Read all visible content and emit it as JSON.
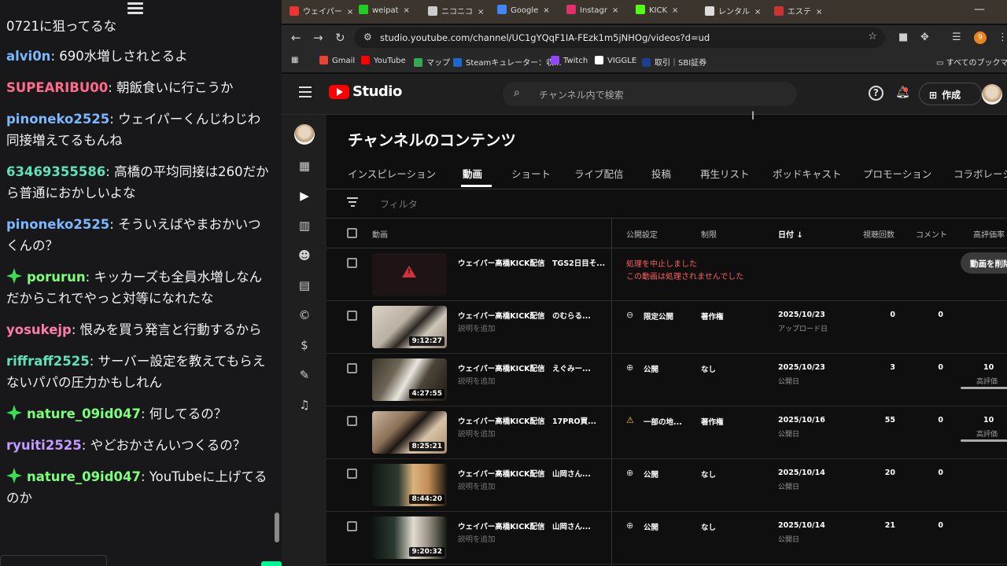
{
  "chat": {
    "first_line": "0721に狙ってるな",
    "messages": [
      {
        "user": "alvi0n",
        "color": "#7ab8ff",
        "badge": false,
        "text": "690水増しされとるよ"
      },
      {
        "user": "SUPEARIBU00",
        "color": "#ff6b8a",
        "badge": false,
        "text": "朝飯食いに行こうか"
      },
      {
        "user": "pinoneko2525",
        "color": "#7ab8ff",
        "badge": false,
        "text": "ウェイパーくんじわじわ同接増えてるもんね"
      },
      {
        "user": "63469355586",
        "color": "#5fe0b8",
        "badge": false,
        "text": "高橋の平均同接は260だから普通におかしいよな"
      },
      {
        "user": "pinoneko2525",
        "color": "#7ab8ff",
        "badge": false,
        "text": "そういえばやまおかいつくんの？"
      },
      {
        "user": "porurun",
        "color": "#7dff7a",
        "badge": true,
        "text": "キッカーズも全員水増しなんだからこれでやっと対等になれたな"
      },
      {
        "user": "yosukejp",
        "color": "#ff7aa6",
        "badge": false,
        "text": "恨みを買う発言と行動するから"
      },
      {
        "user": "riffraff2525",
        "color": "#5fe0b8",
        "badge": false,
        "text": "サーバー設定を教えてもらえないパパの圧力かもしれん"
      },
      {
        "user": "nature_09id047",
        "color": "#7dff7a",
        "badge": true,
        "text": "何してるの？"
      },
      {
        "user": "ryuiti2525",
        "color": "#c29bff",
        "badge": false,
        "text": "やどおかさんいつくるの？"
      },
      {
        "user": "nature_09id047",
        "color": "#7dff7a",
        "badge": true,
        "text": "YouTubeに上げてるのか"
      }
    ]
  },
  "browser": {
    "tabs": [
      {
        "label": "ウェイパー",
        "color": "#e33"
      },
      {
        "label": "weipat",
        "color": "#2c2"
      },
      {
        "label": "ニコニコ",
        "color": "#ccc"
      },
      {
        "label": "Google",
        "color": "#4285f4"
      },
      {
        "label": "Instagr",
        "color": "#e1306c"
      },
      {
        "label": "KICK",
        "color": "#53fc18"
      },
      {
        "label": "レンタル",
        "color": "#ddd"
      },
      {
        "label": "エステ",
        "color": "#c33"
      }
    ],
    "url": "studio.youtube.com/channel/UC1gYQqF1IA-FEzk1m5jNHOg/videos?d=ud",
    "ext_badge": "9",
    "bookmarks": [
      {
        "label": "Gmail",
        "color": "#ea4335"
      },
      {
        "label": "YouTube",
        "color": "#ff0000"
      },
      {
        "label": "マップ",
        "color": "#34a853"
      },
      {
        "label": "Steamキュレーター：収...",
        "color": "#1b6ac9"
      },
      {
        "label": "Twitch",
        "color": "#9146ff"
      },
      {
        "label": "VIGGLE",
        "color": "#ffffff"
      },
      {
        "label": "取引｜SBI証券",
        "color": "#1c3f94"
      }
    ],
    "all_bookmarks": "すべてのブックマーク"
  },
  "studio": {
    "logo_text": "Studio",
    "search_placeholder": "チャンネル内で検索",
    "create_label": "作成",
    "page_title": "チャンネルのコンテンツ",
    "tabs": [
      "インスピレーション",
      "動画",
      "ショート",
      "ライブ配信",
      "投稿",
      "再生リスト",
      "ポッドキャスト",
      "プロモーション",
      "コラボレーシ"
    ],
    "active_tab": "動画",
    "filter_placeholder": "フィルタ",
    "columns": {
      "video": "動画",
      "visibility": "公開設定",
      "restrictions": "制限",
      "date": "日付 ↓",
      "views": "視聴回数",
      "comments": "コメント",
      "likes": "高評価率（低"
    },
    "error_row": {
      "title": "ウェイパー高橋KICK配信　TGS2日目そ...",
      "line1": "処理を中止しました",
      "line2": "この動画は処理されませんでした",
      "button": "動画を削除"
    },
    "rows": [
      {
        "title": "ウェイパー高橋KICK配信　のむらる...",
        "desc": "説明を追加",
        "duration": "9:12:27",
        "vis_icon": "link-icon",
        "visibility": "限定公開",
        "restriction": "著作権",
        "date": "2025/10/23",
        "date_sub": "アップロード日",
        "views": "0",
        "comments": "0",
        "likes": "",
        "likes_sub": ""
      },
      {
        "title": "ウェイパー高橋KICK配信　えぐみー...",
        "desc": "説明を追加",
        "duration": "4:27:55",
        "vis_icon": "globe-icon",
        "visibility": "公開",
        "restriction": "なし",
        "date": "2025/10/23",
        "date_sub": "公開日",
        "views": "3",
        "comments": "0",
        "likes": "10",
        "likes_sub": "高評価"
      },
      {
        "title": "ウェイパー高橋KICK配信　17PRO買...",
        "desc": "説明を追加",
        "duration": "8:25:21",
        "vis_icon": "warning-icon",
        "visibility": "一部の地...",
        "restriction": "著作権",
        "date": "2025/10/16",
        "date_sub": "公開日",
        "views": "55",
        "comments": "0",
        "likes": "10",
        "likes_sub": "高評価"
      },
      {
        "title": "ウェイパー高橋KICK配信　山岡さん...",
        "desc": "説明を追加",
        "duration": "8:44:20",
        "vis_icon": "globe-icon",
        "visibility": "公開",
        "restriction": "なし",
        "date": "2025/10/14",
        "date_sub": "公開日",
        "views": "20",
        "comments": "0",
        "likes": "",
        "likes_sub": ""
      },
      {
        "title": "ウェイパー高橋KICK配信　山岡さん...",
        "desc": "説明を追加",
        "duration": "9:20:32",
        "vis_icon": "globe-icon",
        "visibility": "公開",
        "restriction": "なし",
        "date": "2025/10/14",
        "date_sub": "公開日",
        "views": "21",
        "comments": "0",
        "likes": "",
        "likes_sub": ""
      }
    ]
  }
}
